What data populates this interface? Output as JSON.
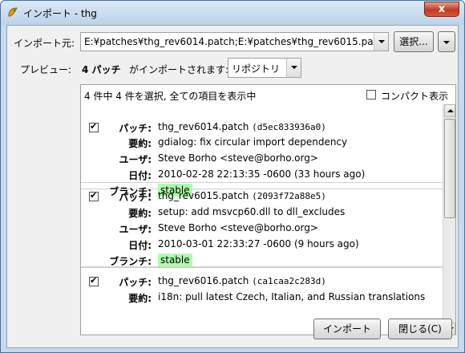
{
  "window": {
    "title": "インポート - thg",
    "close_glyph": "x"
  },
  "source": {
    "label": "インポート元:",
    "value": "E:¥patches¥thg_rev6014.patch;E:¥patches¥thg_rev6015.pa",
    "browse_label": "選択..."
  },
  "preview": {
    "label": "プレビュー:",
    "summary_count": "4 パッチ",
    "summary_text": "がインポートされます:",
    "target": "リポジトリ"
  },
  "list_header": {
    "selection_text": "4 件中 4 件を選択, 全ての項目を表示中",
    "compact_label": "コンパクト表示"
  },
  "field_labels": {
    "patch": "パッチ:",
    "summary": "要約:",
    "user": "ユーザ:",
    "date": "日付:",
    "branch": "ブランチ:"
  },
  "patches": [
    {
      "checked": true,
      "file": "thg_rev6014.patch",
      "hash": "(d5ec833936a0)",
      "summary": "gdialog: fix circular import dependency",
      "user": "Steve Borho <steve@borho.org>",
      "date": "2010-02-28 22:13:35 -0600 (33 hours ago)",
      "branch": "stable"
    },
    {
      "checked": true,
      "file": "thg_rev6015.patch",
      "hash": "(2093f72a88e5)",
      "summary": "setup: add msvcp60.dll to dll_excludes",
      "user": "Steve Borho <steve@borho.org>",
      "date": "2010-03-01 22:33:27 -0600 (9 hours ago)",
      "branch": "stable"
    },
    {
      "checked": true,
      "file": "thg_rev6016.patch",
      "hash": "(ca1caa2c283d)",
      "summary": "i18n: pull latest Czech, Italian, and Russian translations",
      "user": "",
      "date": "",
      "branch": ""
    }
  ],
  "buttons": {
    "import": "インポート",
    "close": "閉じる(C)"
  }
}
